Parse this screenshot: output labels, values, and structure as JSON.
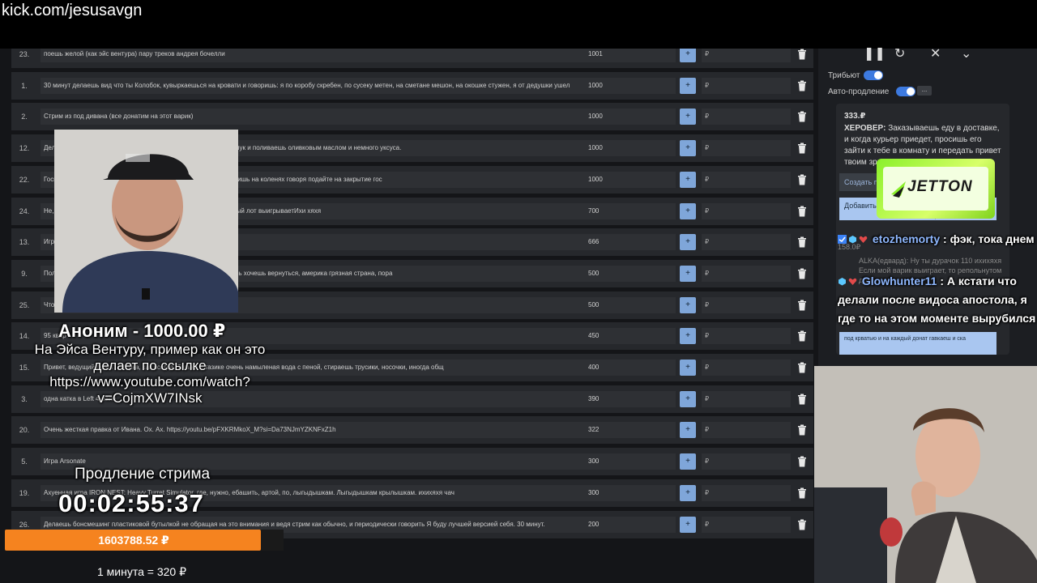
{
  "url_bar": {
    "text": "kick.com/jesusavgn"
  },
  "colors": {
    "accent_blue": "#7fa6d9",
    "toggle_blue": "#3d7ae0",
    "progress_orange": "#f5831f",
    "jetton_green": "#8af02a",
    "chat_username": "#8fb8ff"
  },
  "icons": {
    "row_action": "trash-icon",
    "row_add": "plus-icon",
    "controls": [
      "pause-icon",
      "refresh-icon",
      "close-icon",
      "chevron-down-icon"
    ]
  },
  "lots": [
    {
      "num": "23.",
      "text": "поешь желой (как эйс вентура) пару треков андрея бочелли",
      "amount": "1001",
      "currency": "₽"
    },
    {
      "num": "1.",
      "text": "30 минут делаешь вид что ты Колобок, кувыркаешься на кровати и говоришь: я по коробу скребен, по сусеку метен, на сметане мешон, на окошке стужен, я от дедушки ушел",
      "amount": "1000",
      "currency": "₽"
    },
    {
      "num": "2.",
      "text": "Стрим из под дивана (все донатим на этот варик)",
      "amount": "1000",
      "currency": "₽"
    },
    {
      "num": "12.",
      "text": "Делаешь салат, режешь сыр, режешь оливки, режешь красный лук и поливаешь оливковым маслом и немного уксуса.",
      "amount": "1000",
      "currency": "₽"
    },
    {
      "num": "22.",
      "text": "Господи, следует из официальных данных. Так что 30 минут стоишь на коленях говоря подайте на закрытие гос",
      "amount": "1000",
      "currency": "₽"
    },
    {
      "num": "24.",
      "text": "Не, ну теперь пиво не за что братьЗакинь что третий репольнутый лот выигрываетИхи хяхя",
      "amount": "700",
      "currency": "₽"
    },
    {
      "num": "13.",
      "text": "Играешь",
      "amount": "666",
      "currency": "₽"
    },
    {
      "num": "9.",
      "text": "Полчаса нецк. Билеты можно не покупать, но говоришь что очень хочешь вернуться, америка грязная страна, пора",
      "amount": "500",
      "currency": "₽"
    },
    {
      "num": "25.",
      "text": "Что д https://youtu.be/6gUC9Cbjz7o?si=AqcMOqinlhax2uud",
      "amount": "500",
      "currency": "₽"
    },
    {
      "num": "14.",
      "text": "95 квар",
      "amount": "450",
      "currency": "₽"
    },
    {
      "num": "15.",
      "text": "Привет, ведущий донат! Стирка, как всегда. Только в тазике очень намыленая вода с пеной, стираешь трусики, носочки, иногда общ",
      "amount": "400",
      "currency": "₽"
    },
    {
      "num": "3.",
      "text": "одна катка в Left 4 мапе",
      "amount": "390",
      "currency": "₽"
    },
    {
      "num": "20.",
      "text": "Очень жесткая правка от Ивана. Ох. Ах. https://youtu.be/pFXKRMkoX_M?si=Da73NJmYZKNFxZ1h",
      "amount": "322",
      "currency": "₽"
    },
    {
      "num": "5.",
      "text": "Игра Arsonate",
      "amount": "300",
      "currency": "₽"
    },
    {
      "num": "19.",
      "text": "Ахуенная игра IRON NEST: Heavy Turret Simulator, где, нужно, ебашить, артой, по, лыгыдышкам. Лыгыдышкам крылышкам. ихихяхя чач",
      "amount": "300",
      "currency": "₽"
    },
    {
      "num": "26.",
      "text": "Делаешь бонсмешинг пластиковой бутылкой не обращая на это внимания и ведя стрим как обычно, и периодически говорить Я буду лучшей версией себя. 30 минут.",
      "amount": "200",
      "currency": "₽"
    }
  ],
  "right_panel": {
    "tribute_label": "Трибьют",
    "autoextend_label": "Авто-продление",
    "dots": "...",
    "card": {
      "price": "333.₽",
      "author": "ХЕРОВЕР:",
      "text": "Заказываешь еду в доставке, и когда курьер приедет, просишь его зайти к тебе в комнату и передать привет твоим зрителям и",
      "btn_create": "Создать по",
      "btn_add": "Добавить",
      "btn_add_suffix": "Накопила на свой пер",
      "faded_price": "158.0₽",
      "faded_text": "ALKA(едвард): Ну ты дурачок 110 ихихяхя Если мой варик выиграет, то репольнутом доте",
      "btn_bottom": "под крватью и на каждый донат гавкаеш и ска"
    }
  },
  "jetton": {
    "logo_text": "JETTON"
  },
  "chat": [
    {
      "user": "etozhemorty",
      "sep": " : ",
      "msg": "фэк, тока днем"
    },
    {
      "user": "Glowhunter11",
      "sep": " : ",
      "msg": "А кстати что делали после видоса апостола, я где то на этом моменте вырубился"
    }
  ],
  "donation": {
    "donor": "Аноним - 1000.00 ₽",
    "message": "На Эйса Вентуру, пример как он это делает по ссылке https://www.youtube.com/watch?v=CojmXW7INsk"
  },
  "timer": {
    "label": "Продление стрима",
    "value": "00:02:55:37"
  },
  "progress": {
    "value_text": "1603788.52 ₽",
    "fill_percent": 92
  },
  "rate": {
    "text": "1 минута = 320 ₽"
  }
}
